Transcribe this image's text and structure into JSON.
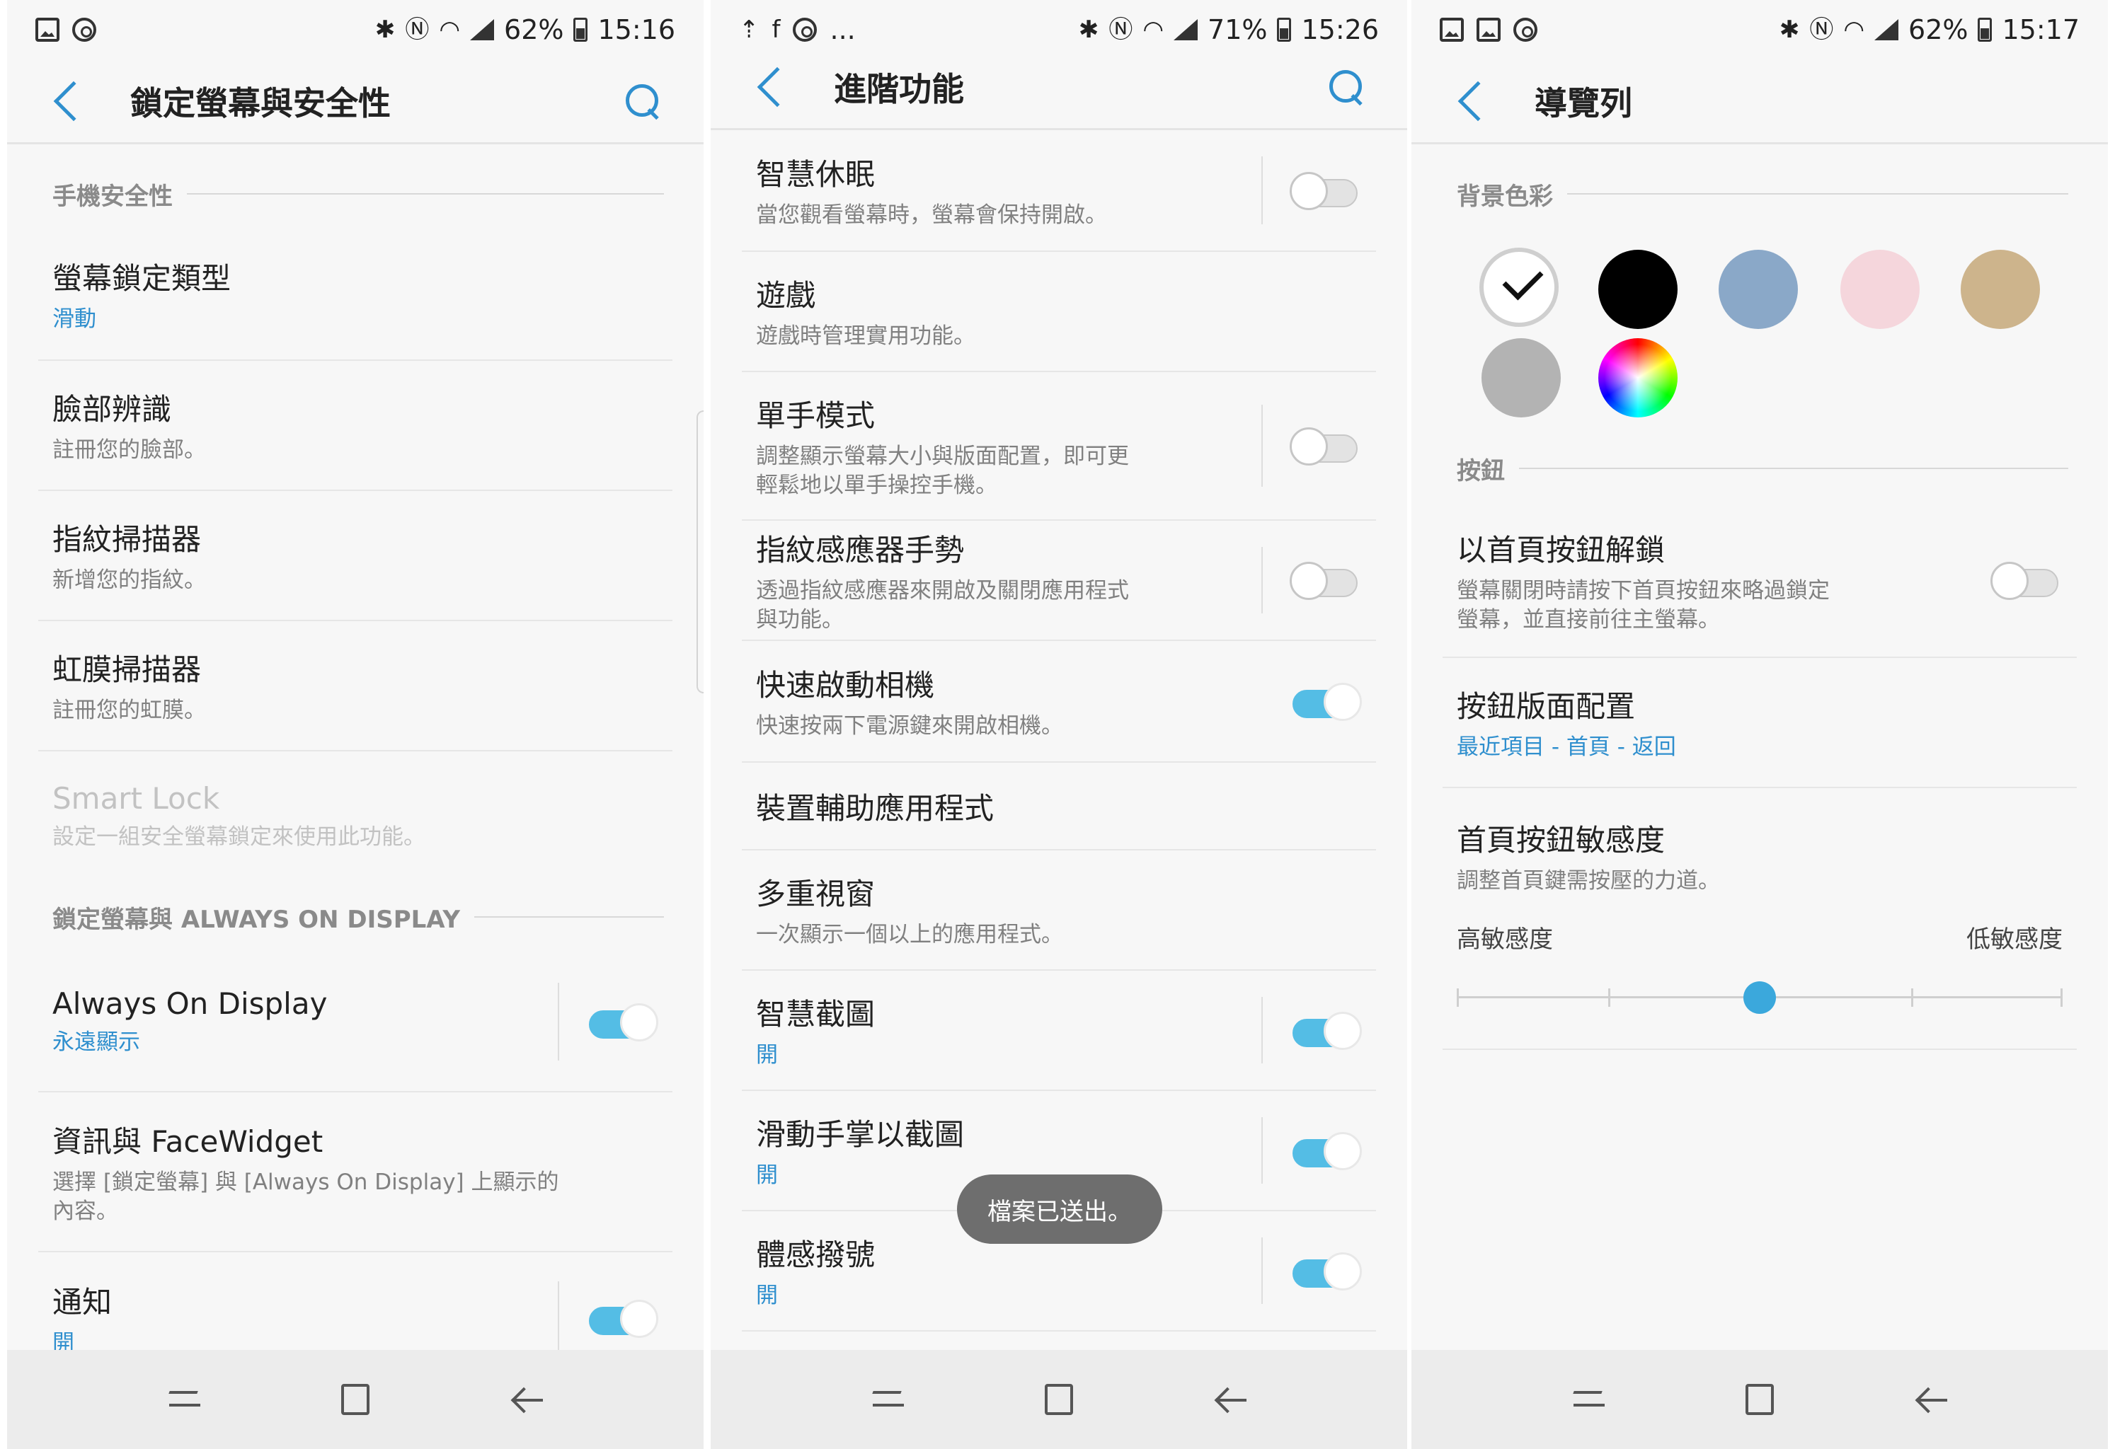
{
  "panel1": {
    "status": {
      "battery": "62%",
      "time": "15:16"
    },
    "title": "鎖定螢幕與安全性",
    "section_security": "手機安全性",
    "items": [
      {
        "title": "螢幕鎖定類型",
        "subtitle": "滑動"
      },
      {
        "title": "臉部辨識",
        "subtitle": "註冊您的臉部。"
      },
      {
        "title": "指紋掃描器",
        "subtitle": "新增您的指紋。"
      },
      {
        "title": "虹膜掃描器",
        "subtitle": "註冊您的虹膜。"
      },
      {
        "title": "Smart Lock",
        "subtitle": "設定一組安全螢幕鎖定來使用此功能。"
      }
    ],
    "section_aod": "鎖定螢幕與 ALWAYS ON DISPLAY",
    "items2": [
      {
        "title": "Always On Display",
        "subtitle": "永遠顯示",
        "toggle": true
      },
      {
        "title": "資訊與 FaceWidget",
        "subtitle": "選擇 [鎖定螢幕] 與 [Always On Display] 上顯示的內容。"
      },
      {
        "title": "通知",
        "subtitle": "開",
        "toggle": true
      }
    ]
  },
  "panel2": {
    "status": {
      "battery": "71%",
      "time": "15:26",
      "more": "..."
    },
    "title": "進階功能",
    "items": [
      {
        "title": "智慧休眠",
        "subtitle": "當您觀看螢幕時，螢幕會保持開啟。",
        "toggle": false
      },
      {
        "title": "遊戲",
        "subtitle": "遊戲時管理實用功能。"
      },
      {
        "title": "單手模式",
        "subtitle": "調整顯示螢幕大小與版面配置，即可更輕鬆地以單手操控手機。",
        "toggle": false
      },
      {
        "title": "指紋感應器手勢",
        "subtitle": "透過指紋感應器來開啟及關閉應用程式與功能。",
        "toggle": false
      },
      {
        "title": "快速啟動相機",
        "subtitle": "快速按兩下電源鍵來開啟相機。",
        "toggle": true
      },
      {
        "title": "裝置輔助應用程式"
      },
      {
        "title": "多重視窗",
        "subtitle": "一次顯示一個以上的應用程式。"
      },
      {
        "title": "智慧截圖",
        "subtitle": "開",
        "toggle": true
      },
      {
        "title": "滑動手掌以截圖",
        "subtitle": "開",
        "toggle": true
      },
      {
        "title": "體感撥號",
        "subtitle": "開",
        "toggle": true
      }
    ],
    "toast": "檔案已送出。"
  },
  "panel3": {
    "status": {
      "battery": "62%",
      "time": "15:17"
    },
    "title": "導覽列",
    "section_bg": "背景色彩",
    "colors": [
      "#ffffff",
      "#000000",
      "#8aa8c8",
      "#f5d6dc",
      "#cdb48c",
      "#b3b3b3",
      "multicolor"
    ],
    "section_buttons": "按鈕",
    "items": [
      {
        "title": "以首頁按鈕解鎖",
        "subtitle": "螢幕關閉時請按下首頁按鈕來略過鎖定螢幕，並直接前往主螢幕。",
        "toggle": false
      },
      {
        "title": "按鈕版面配置",
        "subtitle": "最近項目 - 首頁 - 返回"
      },
      {
        "title": "首頁按鈕敏感度",
        "subtitle": "調整首頁鍵需按壓的力道。"
      }
    ],
    "slider": {
      "low_label": "高敏感度",
      "high_label": "低敏感度",
      "value": 2,
      "steps": 5
    }
  }
}
